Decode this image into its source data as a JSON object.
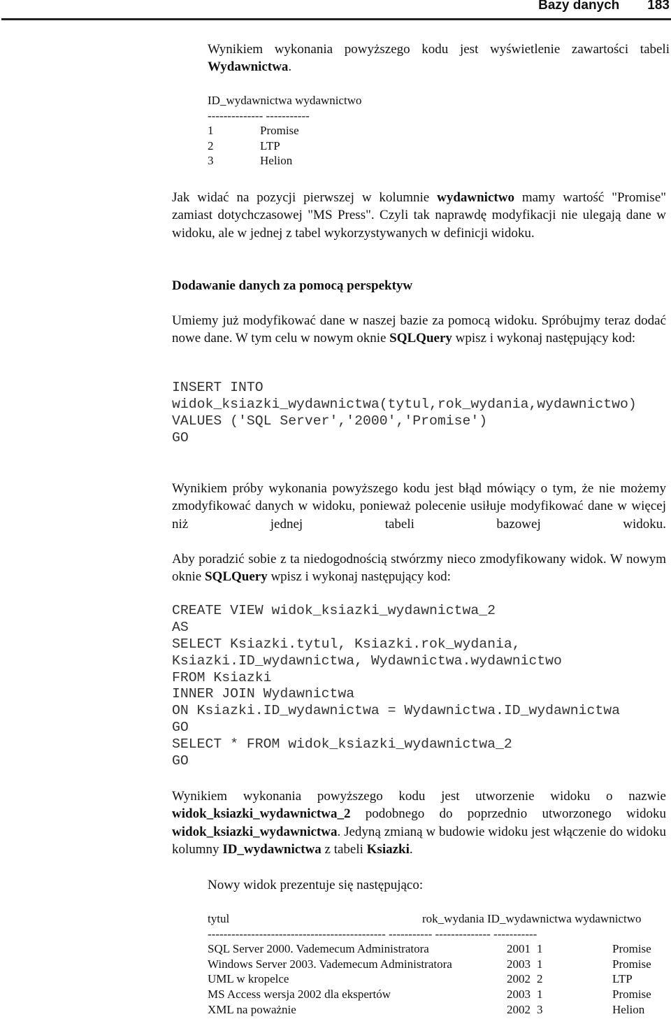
{
  "header": {
    "title": "Bazy danych",
    "page": "183"
  },
  "p1": [
    {
      "t": "Wynikiem wykonania powyższego kodu jest wyświetlenie zawartości tabeli "
    },
    {
      "t": "Wydawnictwa",
      "b": true
    },
    {
      "t": "."
    }
  ],
  "table1": {
    "headers": "ID_wydawnictwa wydawnictwo",
    "dashes": "-------------- -----------",
    "rows": [
      [
        "1",
        "Promise"
      ],
      [
        "2",
        "LTP"
      ],
      [
        "3",
        "Helion"
      ]
    ]
  },
  "p2": [
    {
      "t": "Jak widać na pozycji pierwszej w kolumnie "
    },
    {
      "t": "wydawnictwo",
      "b": true
    },
    {
      "t": " mamy wartość \"Promise\" zamiast dotychczasowej \"MS Press\". Czyli tak naprawdę modyfikacji nie ulegają dane w widoku, ale w jednej z tabel wykorzystywanych w definicji widoku."
    }
  ],
  "heading": "Dodawanie danych za pomocą perspektyw",
  "p3": [
    {
      "t": "Umiemy już modyfikować dane w naszej bazie za pomocą widoku. Spróbujmy teraz dodać nowe dane. W tym celu w nowym oknie "
    },
    {
      "t": "SQLQuery",
      "b": true
    },
    {
      "t": " wpisz i wykonaj następujący kod:"
    }
  ],
  "code1": [
    "INSERT INTO",
    "widok_ksiazki_wydawnictwa(tytul,rok_wydania,wydawnictwo)",
    "VALUES ('SQL Server','2000','Promise')",
    "GO"
  ],
  "p4": [
    {
      "t": "Wynikiem próby wykonania powyższego kodu jest błąd mówiący o tym, że nie możemy zmodyfikować danych w widoku, ponieważ polecenie usiłuje modyfikować dane w więcej niż jednej tabeli bazowej widoku."
    }
  ],
  "p5": [
    {
      "t": "Aby poradzić sobie z ta niedogodnością stwórzmy nieco zmodyfikowany widok. W nowym oknie "
    },
    {
      "t": "SQLQuery",
      "b": true
    },
    {
      "t": " wpisz i wykonaj następujący kod:"
    }
  ],
  "code2": [
    "CREATE VIEW widok_ksiazki_wydawnictwa_2",
    "AS",
    "SELECT Ksiazki.tytul, Ksiazki.rok_wydania,",
    "Ksiazki.ID_wydawnictwa, Wydawnictwa.wydawnictwo",
    "FROM Ksiazki",
    "INNER JOIN Wydawnictwa",
    "ON Ksiazki.ID_wydawnictwa = Wydawnictwa.ID_wydawnictwa",
    "GO",
    "SELECT * FROM widok_ksiazki_wydawnictwa_2",
    "GO"
  ],
  "p6": [
    {
      "t": "Wynikiem wykonania powyższego kodu jest utworzenie widoku o nazwie "
    },
    {
      "t": "widok_ksiazki_wydawnictwa_2",
      "b": true
    },
    {
      "t": " podobnego do poprzednio utworzonego widoku "
    },
    {
      "t": "widok_ksiazki_wydawnictwa",
      "b": true
    },
    {
      "t": ". Jedyną zmianą w budowie widoku jest włączenie do widoku kolumny "
    },
    {
      "t": "ID_wydawnictwa",
      "b": true
    },
    {
      "t": " z tabeli "
    },
    {
      "t": "Ksiazki",
      "b": true
    },
    {
      "t": "."
    }
  ],
  "p7": [
    {
      "t": "Nowy widok prezentuje się następująco:"
    }
  ],
  "table2": {
    "headers": [
      "tytul",
      "rok_wydania ID_wydawnictwa wydawnictwo"
    ],
    "dashes": "--------------------------------------------- ----------- -------------- -----------",
    "rows": [
      [
        "SQL Server 2000. Vademecum Administratora",
        "2001",
        "1",
        "Promise"
      ],
      [
        "Windows Server 2003. Vademecum Administratora",
        "2003",
        "1",
        "Promise"
      ],
      [
        "UML w kropelce",
        "2002",
        "2",
        "LTP"
      ],
      [
        "MS Access wersja 2002 dla ekspertów",
        "2003",
        "1",
        "Promise"
      ],
      [
        "XML na poważnie",
        "2002",
        "3",
        "Helion"
      ]
    ]
  }
}
